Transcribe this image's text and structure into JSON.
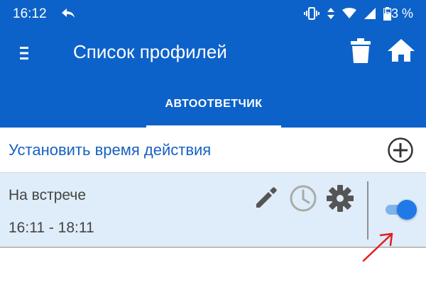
{
  "status_bar": {
    "time": "16:12",
    "battery_percent": "53 %"
  },
  "toolbar": {
    "title": "Список профилей"
  },
  "tabs": [
    {
      "label": "АВТООТВЕТЧИК",
      "selected": true
    }
  ],
  "set_time": {
    "label": "Установить время действия"
  },
  "profiles": [
    {
      "name": "На встрече",
      "time_range": "16:11 - 18:11",
      "enabled": true
    }
  ],
  "colors": {
    "primary": "#0d62c9",
    "accent": "#1761c3",
    "item_background": "#dfecf9",
    "toggle_on": "#1f7ae8",
    "annotation": "#e01f1f"
  }
}
